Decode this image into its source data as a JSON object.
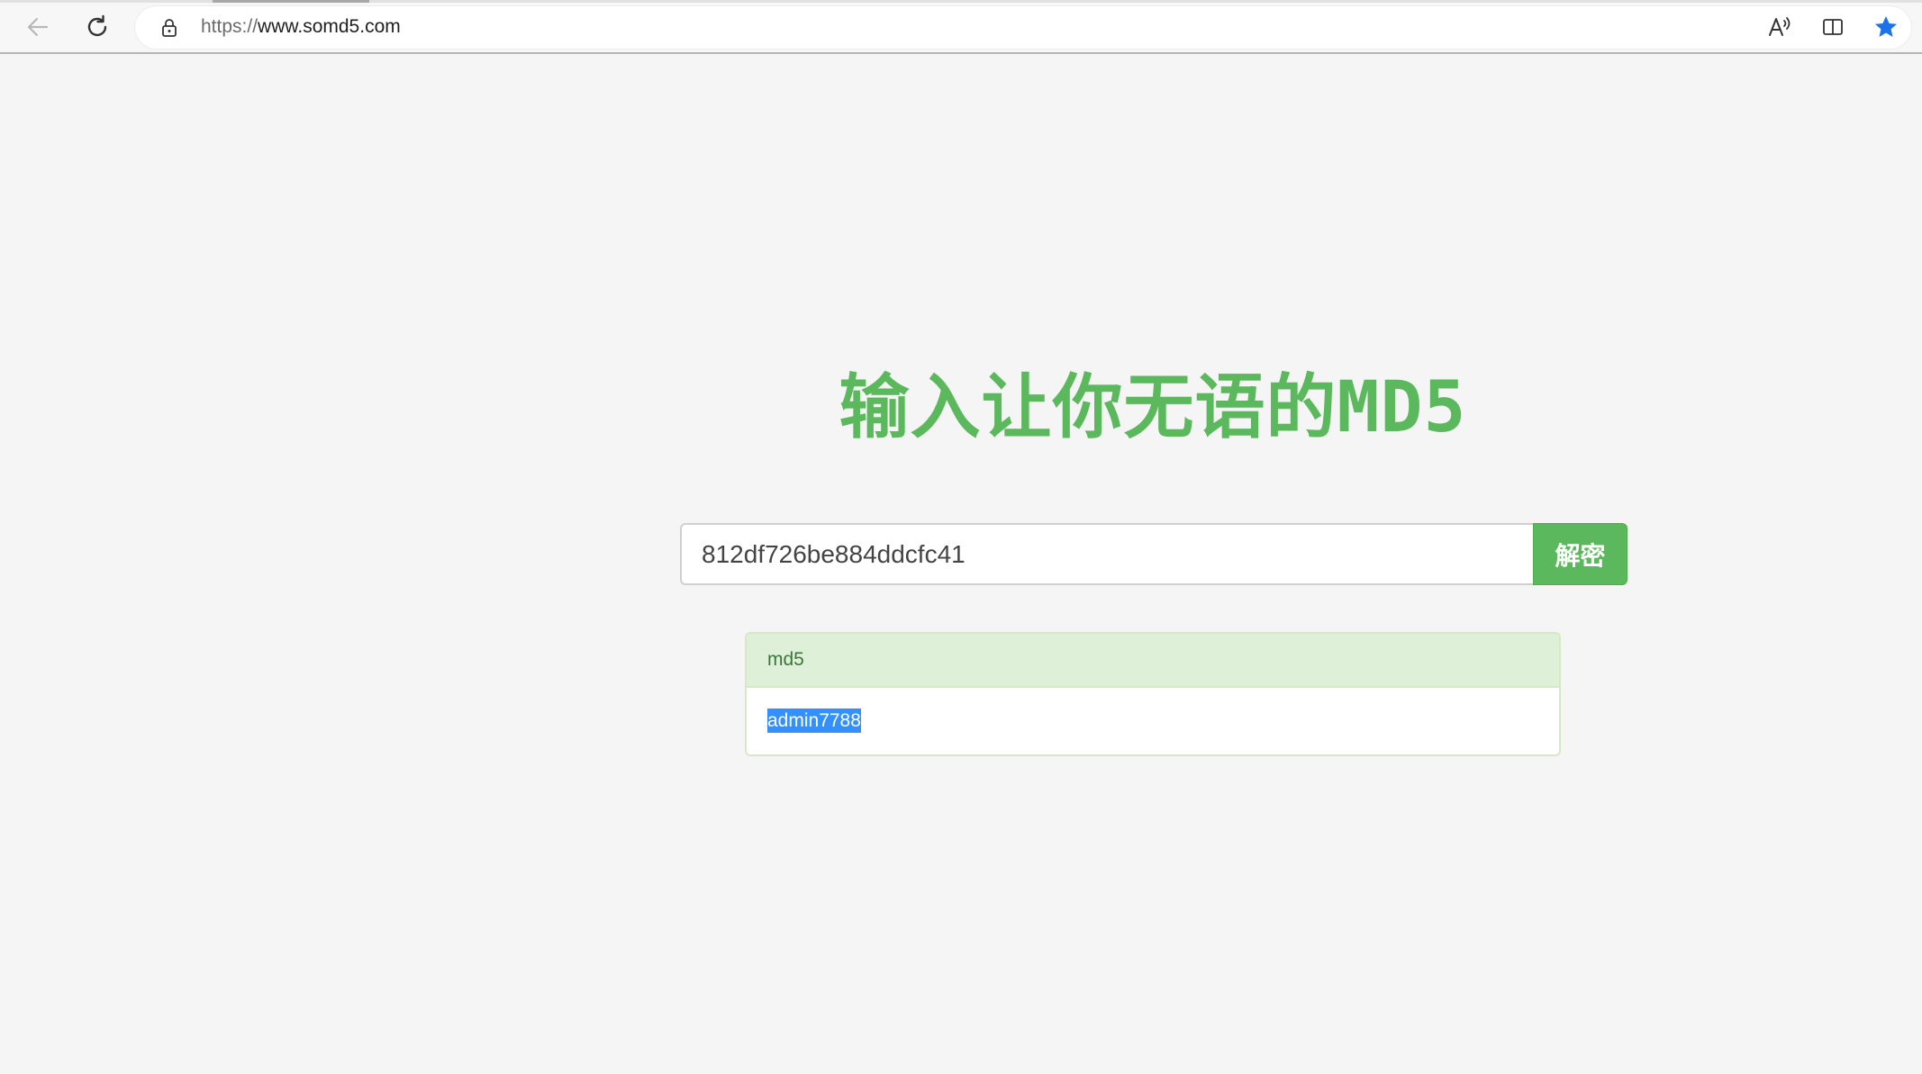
{
  "browser": {
    "url_scheme": "https://",
    "url_host": "www.somd5.com",
    "icons": {
      "back": "arrow-left-icon",
      "reload": "reload-icon",
      "lock": "lock-icon",
      "read_aloud": "read-aloud-icon",
      "split_screen": "split-screen-icon",
      "favorite": "star-icon"
    },
    "colors": {
      "favorite_star": "#1a73e8"
    }
  },
  "page": {
    "title": "输入让你无语的MD5",
    "title_color": "#5cb85c",
    "search": {
      "value": "812df726be884ddcfc41",
      "button_label": "解密",
      "button_color": "#5cb85c"
    },
    "result": {
      "heading": "md5",
      "value": "admin7788",
      "heading_bg": "#dff0d8",
      "selection_color": "#3390ff"
    }
  }
}
